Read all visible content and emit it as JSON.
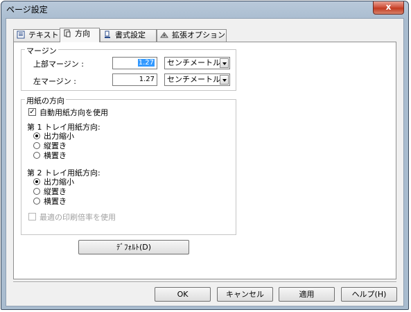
{
  "window": {
    "title": "ページ設定",
    "close_glyph": "x"
  },
  "tabs": [
    {
      "label": "テキスト",
      "icon": "text-page-icon"
    },
    {
      "label": "方向",
      "icon": "orientation-icon"
    },
    {
      "label": "書式設定",
      "icon": "format-icon"
    },
    {
      "label": "拡張オプション",
      "icon": "extended-options-icon"
    }
  ],
  "margin": {
    "group_label": "マージン",
    "top_label": "上部マージン :",
    "top_value": "1.27",
    "top_unit": "センチメートル",
    "left_label": "左マージン :",
    "left_value": "1.27",
    "left_unit": "センチメートル"
  },
  "orientation": {
    "group_label": "用紙の方向",
    "auto_label": "自動用紙方向を使用",
    "auto_checked": true,
    "tray1_label": "第 1 トレイ用紙方向:",
    "tray1_options": [
      "出力縮小",
      "縦置き",
      "横置き"
    ],
    "tray1_selected": 0,
    "tray2_label": "第 2 トレイ用紙方向:",
    "tray2_options": [
      "出力縮小",
      "縦置き",
      "横置き"
    ],
    "tray2_selected": 0,
    "best_scale_label": "最適の印刷倍率を使用",
    "best_scale_checked": false
  },
  "default_button": "ﾃﾞﾌｫﾙﾄ(D)",
  "footer": {
    "ok": "OK",
    "cancel": "キャンセル",
    "apply": "適用",
    "help": "ヘルプ(H)"
  }
}
